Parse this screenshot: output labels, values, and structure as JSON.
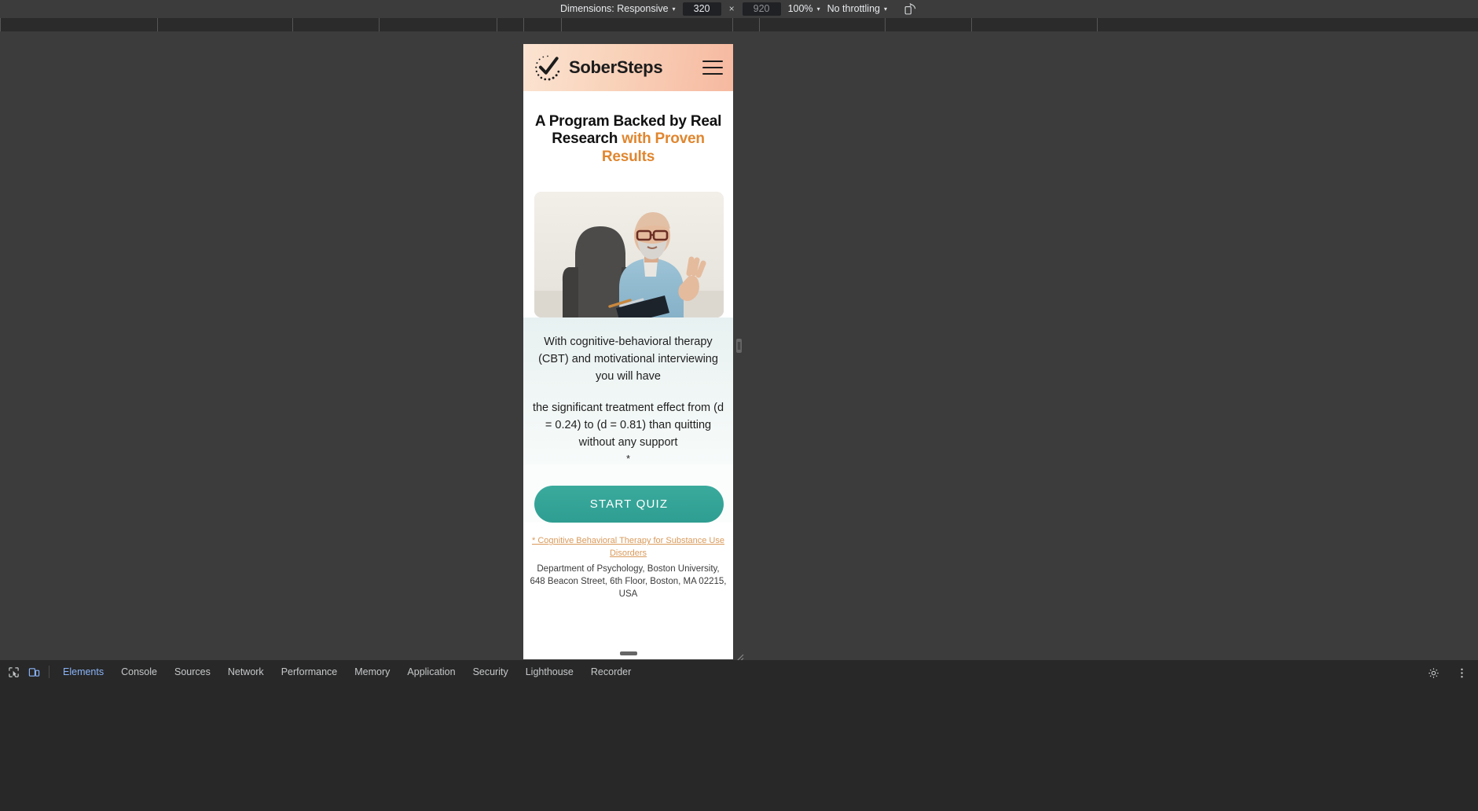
{
  "devtools_toolbar": {
    "dimensions_label": "Dimensions: Responsive",
    "width_value": "320",
    "height_placeholder": "920",
    "times": "×",
    "zoom_label": "100%",
    "throttling_label": "No throttling",
    "rotate_icon": "rotate-device-icon",
    "caret": "▾"
  },
  "page": {
    "header": {
      "logo_icon": "checkmark-circle-logo",
      "brand": "SoberSteps",
      "menu_icon": "hamburger-menu-icon"
    },
    "hero": {
      "headline_part1": "A Program Backed by Real Research ",
      "headline_accent": "with Proven Results",
      "photo_alt": "therapist-seated-in-armchair-photo",
      "paragraph1": "With cognitive-behavioral therapy (CBT) and motivational interviewing you will have",
      "paragraph2": "the significant treatment effect from (d = 0.24) to (d = 0.81) than quitting without any support",
      "asterisk": "*",
      "cta_label": "START QUIZ",
      "footnote_link": "* Cognitive Behavioral Therapy for Substance Use Disorders",
      "footnote_address": "Department of Psychology, Boston University, 648 Beacon Street, 6th Floor, Boston, MA 02215, USA"
    }
  },
  "devtools_bottom": {
    "inspect_icon": "inspect-element-icon",
    "device_icon": "toggle-device-toolbar-icon",
    "tabs": [
      {
        "label": "Elements",
        "selected": true
      },
      {
        "label": "Console",
        "selected": false
      },
      {
        "label": "Sources",
        "selected": false
      },
      {
        "label": "Network",
        "selected": false
      },
      {
        "label": "Performance",
        "selected": false
      },
      {
        "label": "Memory",
        "selected": false
      },
      {
        "label": "Application",
        "selected": false
      },
      {
        "label": "Security",
        "selected": false
      },
      {
        "label": "Lighthouse",
        "selected": false
      },
      {
        "label": "Recorder",
        "selected": false
      }
    ],
    "settings_icon": "gear-icon",
    "more_icon": "more-options-icon"
  },
  "colors": {
    "accent_orange": "#e0862f",
    "cta_teal": "#2f9e92",
    "header_peach": "#f7c6a9",
    "devtools_blue": "#8ab4f8"
  }
}
